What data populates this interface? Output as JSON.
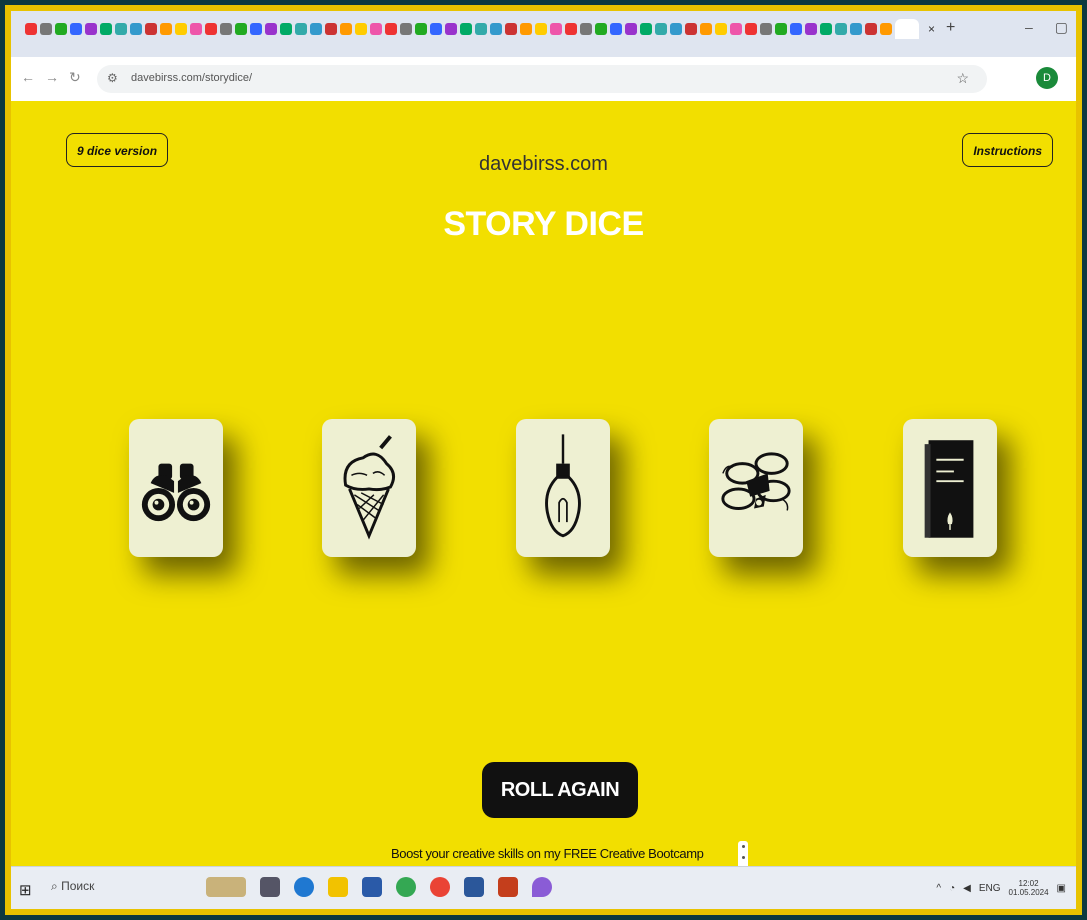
{
  "browser": {
    "tab_close": "×",
    "new_tab": "+",
    "window_controls": {
      "minimize": "–",
      "maximize": "▢"
    },
    "url": "davebirss.com/storydice/",
    "profile_initial": "D"
  },
  "page": {
    "left_button": "9 dice version",
    "right_button": "Instructions",
    "site_name": "davebirss.com",
    "title": "STORY DICE",
    "dice": [
      {
        "icon": "binoculars-icon"
      },
      {
        "icon": "ice-cream-icon"
      },
      {
        "icon": "light-bulb-icon"
      },
      {
        "icon": "drone-icon"
      },
      {
        "icon": "book-icon"
      }
    ],
    "roll_button": "ROLL AGAIN",
    "promo_text": "Boost your creative skills on my FREE Creative Bootcamp"
  },
  "taskbar": {
    "search_placeholder": "Поиск",
    "lang": "ENG",
    "time": "12:02",
    "date": "01.05.2024"
  },
  "colors": {
    "page_bg": "#f2df00",
    "title": "#ffffff",
    "die_face": "#eef0d2",
    "button_dark": "#111111"
  }
}
